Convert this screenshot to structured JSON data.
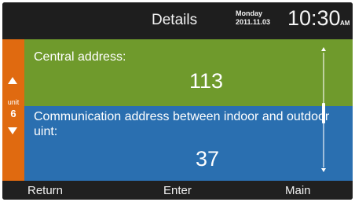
{
  "header": {
    "title": "Details",
    "day": "Monday",
    "date": "2011.11.03",
    "time": "10:30",
    "ampm": "AM"
  },
  "unit": {
    "label": "unit",
    "number": "6"
  },
  "central": {
    "label": "Central address:",
    "value": "113"
  },
  "communication": {
    "label": "Communication address between indoor and outdoor uint:",
    "value": "37"
  },
  "footer": {
    "return_label": "Return",
    "enter_label": "Enter",
    "main_label": "Main"
  },
  "colors": {
    "green_panel": "#6f9a2c",
    "blue_panel": "#2a6fb0",
    "unit_bar": "#e06a10",
    "background": "#1f1f1f"
  }
}
